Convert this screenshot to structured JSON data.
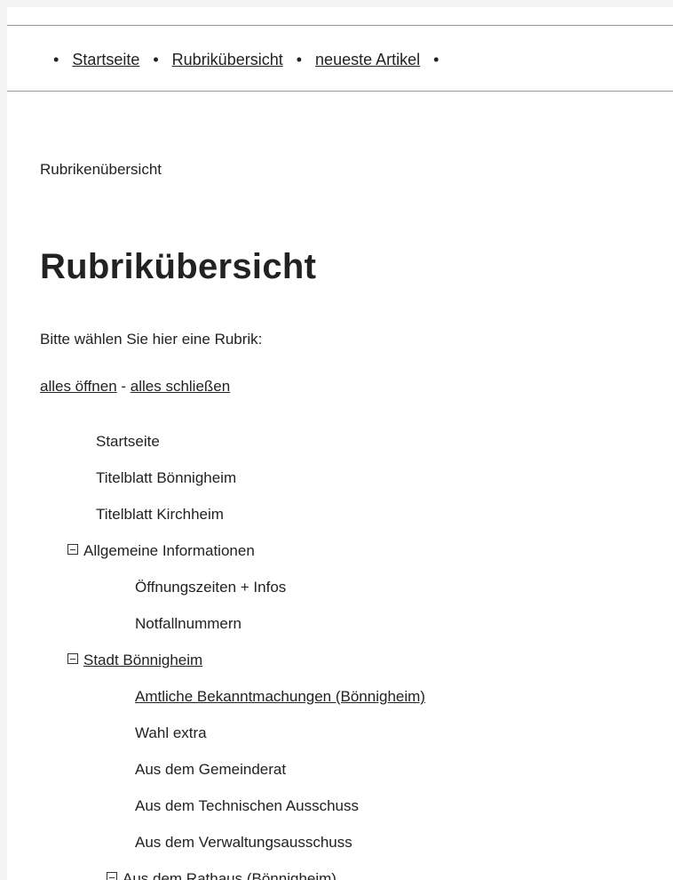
{
  "nav": {
    "items": [
      "Startseite",
      "Rubrikübersicht",
      "neueste Artikel"
    ],
    "bullet": "•"
  },
  "breadcrumb": "Rubrikenübersicht",
  "title": "Rubrikübersicht",
  "intro": "Bitte wählen Sie hier eine Rubrik:",
  "toggle": {
    "open": "alles öffnen",
    "separator": " - ",
    "close": "alles schließen"
  },
  "tree": [
    {
      "label": "Startseite",
      "level": 0,
      "link": false,
      "expanded": null
    },
    {
      "label": "Titelblatt Bönnigheim",
      "level": 0,
      "link": false,
      "expanded": null
    },
    {
      "label": "Titelblatt Kirchheim",
      "level": 0,
      "link": false,
      "expanded": null
    },
    {
      "label": "Allgemeine Informationen",
      "level": 0,
      "link": false,
      "expanded": true
    },
    {
      "label": "Öffnungszeiten + Infos",
      "level": 1,
      "link": false,
      "expanded": null
    },
    {
      "label": "Notfallnummern",
      "level": 1,
      "link": false,
      "expanded": null
    },
    {
      "label": "Stadt Bönnigheim",
      "level": 0,
      "link": true,
      "expanded": true
    },
    {
      "label": "Amtliche Bekanntmachungen (Bönnigheim)",
      "level": 1,
      "link": true,
      "expanded": null
    },
    {
      "label": "Wahl extra",
      "level": 1,
      "link": false,
      "expanded": null
    },
    {
      "label": "Aus dem Gemeinderat",
      "level": 1,
      "link": false,
      "expanded": null
    },
    {
      "label": "Aus dem Technischen Ausschuss",
      "level": 1,
      "link": false,
      "expanded": null
    },
    {
      "label": "Aus dem Verwaltungsausschuss",
      "level": 1,
      "link": false,
      "expanded": null
    },
    {
      "label": "Aus dem Rathaus (Bönnigheim)",
      "level": 1,
      "link": true,
      "expanded": true
    }
  ]
}
